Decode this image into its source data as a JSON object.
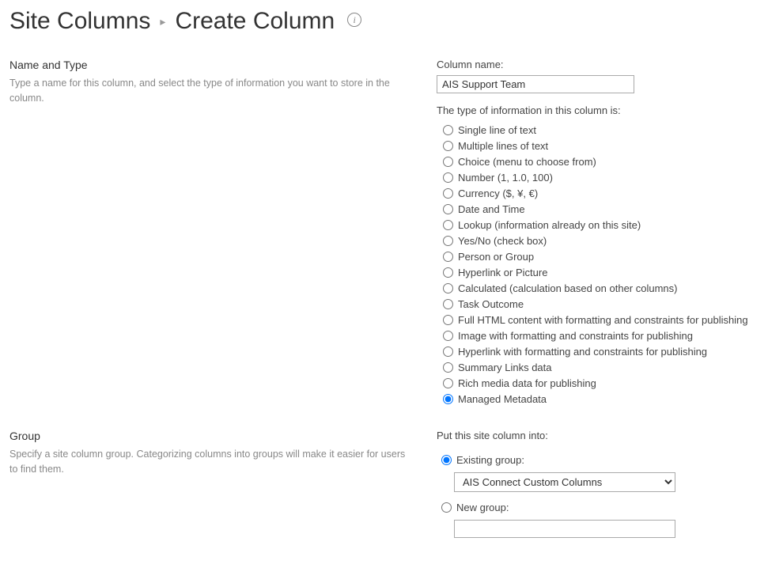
{
  "header": {
    "breadcrumb_site_columns": "Site Columns",
    "caret": "▸",
    "title": "Create Column"
  },
  "section_name_type": {
    "title": "Name and Type",
    "desc": "Type a name for this column, and select the type of information you want to store in the column.",
    "column_name_label": "Column name:",
    "column_name_value": "AIS Support Team",
    "type_label": "The type of information in this column is:",
    "types": [
      "Single line of text",
      "Multiple lines of text",
      "Choice (menu to choose from)",
      "Number (1, 1.0, 100)",
      "Currency ($, ¥, €)",
      "Date and Time",
      "Lookup (information already on this site)",
      "Yes/No (check box)",
      "Person or Group",
      "Hyperlink or Picture",
      "Calculated (calculation based on other columns)",
      "Task Outcome",
      "Full HTML content with formatting and constraints for publishing",
      "Image with formatting and constraints for publishing",
      "Hyperlink with formatting and constraints for publishing",
      "Summary Links data",
      "Rich media data for publishing",
      "Managed Metadata"
    ],
    "type_selected_index": 17
  },
  "section_group": {
    "title": "Group",
    "desc": "Specify a site column group. Categorizing columns into groups will make it easier for users to find them.",
    "put_into_label": "Put this site column into:",
    "existing_label": "Existing group:",
    "existing_selected": "AIS Connect Custom Columns",
    "new_label": "New group:",
    "new_value": "",
    "group_mode_existing": true
  }
}
